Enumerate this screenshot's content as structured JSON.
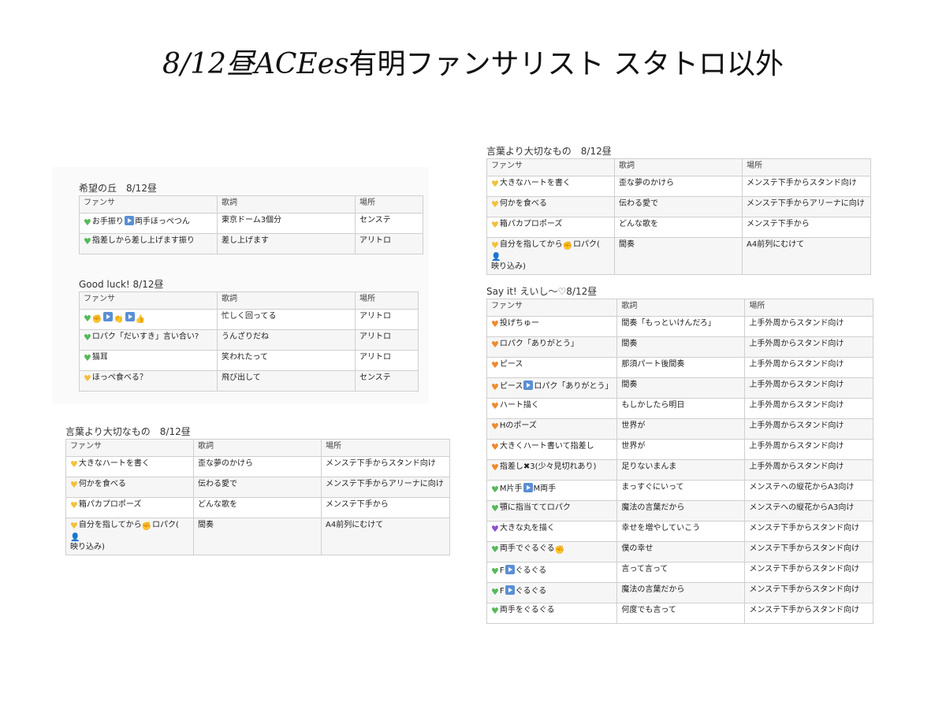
{
  "title": {
    "en": "8/12昼ACEes",
    "jp": "有明ファンサリスト スタトロ以外"
  },
  "colors": {
    "green": "#56b85a",
    "yellow": "#f2c13a",
    "orange": "#ef8a2d",
    "purple": "#8e4fd1",
    "play_button": "#5a8fd4"
  },
  "cols": {
    "fansa": "ファンサ",
    "lyrics": "歌詞",
    "place": "場所"
  },
  "block1": {
    "title": "希望の丘　8/12昼",
    "rows": [
      {
        "heart": "green",
        "fansa_pre": "お手振り",
        "play": true,
        "fansa_post": "両手ほっぺつん",
        "lyrics": "東京ドーム3個分",
        "place": "センステ"
      },
      {
        "heart": "green",
        "fansa": "指差しから差し上げます振り",
        "lyrics": "差し上げます",
        "place": "アリトロ"
      }
    ]
  },
  "block2": {
    "title": "Good luck! 8/12昼",
    "rows": [
      {
        "heart": "green",
        "icons": [
          "fist-icon",
          "play-icon",
          "clap-icon",
          "play-icon",
          "thumbs-up-icon"
        ],
        "lyrics": "忙しく回ってる",
        "place": "アリトロ"
      },
      {
        "heart": "green",
        "fansa": "ロパク「だいすき」言い合い?",
        "lyrics": "うんざりだね",
        "place": "アリトロ"
      },
      {
        "heart": "green",
        "fansa": "猫耳",
        "lyrics": "笑われたって",
        "place": "アリトロ"
      },
      {
        "heart": "yellow",
        "fansa": "ほっぺ食べる？",
        "lyrics": "飛び出して",
        "place": "センステ"
      }
    ]
  },
  "block3": {
    "title": "言葉より大切なもの　8/12昼",
    "rows": [
      {
        "heart": "yellow",
        "fansa": "大きなハートを書く",
        "lyrics": "歪な夢のかけら",
        "place": "メンステ下手からスタンド向け"
      },
      {
        "heart": "yellow",
        "fansa": "何かを食べる",
        "lyrics": "伝わる愛で",
        "place": "メンステ下手からアリーナに向け"
      },
      {
        "heart": "yellow",
        "fansa": "箱パカプロポーズ",
        "lyrics": "どんな歌を",
        "place": "メンステ下手から"
      },
      {
        "heart": "yellow",
        "fansa_pre": "自分を指してから",
        "fansa_mid": "ロパク(",
        "fansa_post": "映り込み)",
        "lyrics": "間奏",
        "place": "A4前列にむけて"
      }
    ]
  },
  "block4": {
    "title": "言葉より大切なもの　8/12昼",
    "rows": [
      {
        "heart": "yellow",
        "fansa": "大きなハートを書く",
        "lyrics": "歪な夢のかけら",
        "place": "メンステ下手からスタンド向け"
      },
      {
        "heart": "yellow",
        "fansa": "何かを食べる",
        "lyrics": "伝わる愛で",
        "place": "メンステ下手からアリーナに向け"
      },
      {
        "heart": "yellow",
        "fansa": "箱パカプロポーズ",
        "lyrics": "どんな歌を",
        "place": "メンステ下手から"
      },
      {
        "heart": "yellow",
        "fansa_pre": "自分を指してから",
        "fansa_mid": "ロパク(",
        "fansa_post": "映り込み)",
        "lyrics": "間奏",
        "place": "A4前列にむけて"
      }
    ]
  },
  "block5": {
    "title": "Say it! えいし〜♡8/12昼",
    "rows": [
      {
        "heart": "orange",
        "fansa": "投げちゅー",
        "lyrics": "間奏「もっといけんだろ」",
        "place": "上手外周からスタンド向け"
      },
      {
        "heart": "orange",
        "fansa": "ロパク「ありがとう」",
        "lyrics": "間奏",
        "place": "上手外周からスタンド向け"
      },
      {
        "heart": "orange",
        "fansa": "ピース",
        "lyrics": "那須パート後間奏",
        "place": "上手外周からスタンド向け"
      },
      {
        "heart": "orange",
        "fansa_pre": "ピース",
        "play": true,
        "fansa_post": "ロパク「ありがとう」",
        "lyrics": "間奏",
        "place": "上手外周からスタンド向け"
      },
      {
        "heart": "orange",
        "fansa": "ハート描く",
        "lyrics": "もしかしたら明日",
        "place": "上手外周からスタンド向け"
      },
      {
        "heart": "orange",
        "fansa": "Hのポーズ",
        "lyrics": "世界が",
        "place": "上手外周からスタンド向け"
      },
      {
        "heart": "orange",
        "fansa": "大きくハート書いて指差し",
        "lyrics": "世界が",
        "place": "上手外周からスタンド向け"
      },
      {
        "heart": "orange",
        "fansa_pre": "指差し",
        "cross": "✖",
        "fansa_post": "3(少々見切れあり)",
        "lyrics": "足りないまんま",
        "place": "上手外周からスタンド向け"
      },
      {
        "heart": "green",
        "fansa_pre": "M片手",
        "play": true,
        "fansa_post": "M両手",
        "lyrics": "まっすぐにいって",
        "place": "メンステへの縦花からA3向け"
      },
      {
        "heart": "green",
        "fansa": "顎に指当ててロパク",
        "lyrics": "魔法の言葉だから",
        "place": "メンステへの縦花からA3向け"
      },
      {
        "heart": "purple",
        "fansa": "大きな丸を描く",
        "lyrics": "幸せを増やしていこう",
        "place": "メンステ下手からスタンド向け"
      },
      {
        "heart": "green",
        "fansa_pre": "両手でぐるぐる",
        "fist_end": true,
        "lyrics": "僕の幸せ",
        "place": "メンステ下手からスタンド向け"
      },
      {
        "heart": "green",
        "fansa_pre": "F",
        "play": true,
        "fansa_post": "ぐるぐる",
        "lyrics": "言って言って",
        "place": "メンステ下手からスタンド向け"
      },
      {
        "heart": "green",
        "fansa_pre": "F",
        "play": true,
        "fansa_post": "ぐるぐる",
        "lyrics": "魔法の言葉だから",
        "place": "メンステ下手からスタンド向け"
      },
      {
        "heart": "green",
        "fansa": "両手をぐるぐる",
        "lyrics": "何度でも言って",
        "place": "メンステ下手からスタンド向け"
      }
    ]
  }
}
